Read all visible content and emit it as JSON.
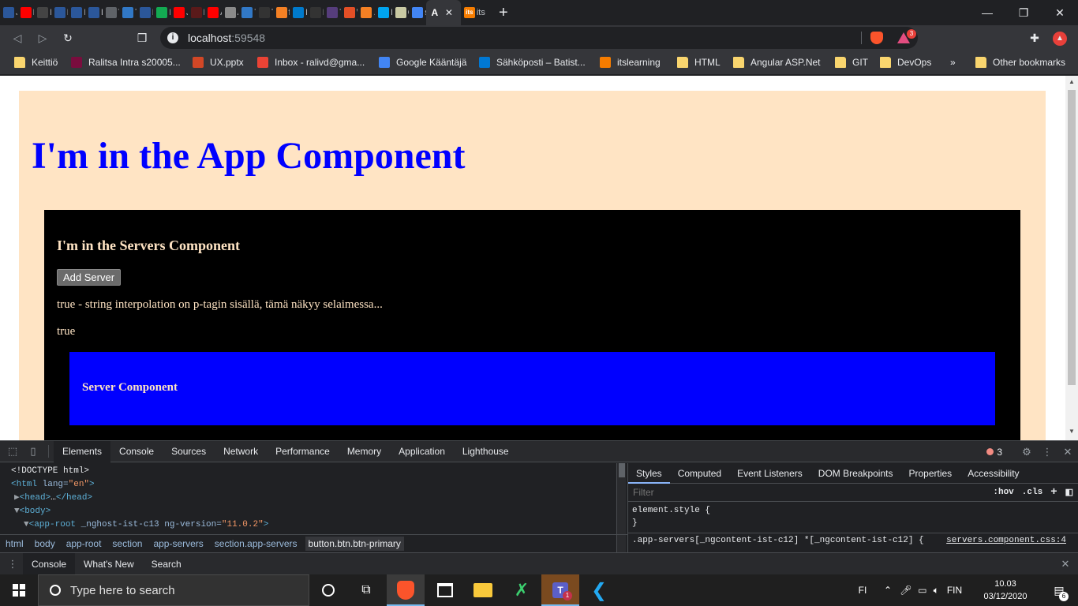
{
  "browser": {
    "tabs": [
      {
        "label": "Ja",
        "icon": "doc-icon",
        "color": "#2b579a"
      },
      {
        "label": "Le",
        "icon": "youtube-icon",
        "color": "#ff0000"
      },
      {
        "label": "Fr",
        "icon": "r-icon",
        "color": "#444444"
      },
      {
        "label": "Le",
        "icon": "doc-icon",
        "color": "#2b579a"
      },
      {
        "label": "Le",
        "icon": "doc-icon",
        "color": "#2b579a"
      },
      {
        "label": "Le",
        "icon": "doc-icon",
        "color": "#2b579a"
      },
      {
        "label": "Th",
        "icon": "globe-icon",
        "color": "#5f6368"
      },
      {
        "label": "Ty",
        "icon": "ts-icon",
        "color": "#3178c6"
      },
      {
        "label": "Le",
        "icon": "doc-icon",
        "color": "#2b579a"
      },
      {
        "label": "Dc",
        "icon": "dc-icon",
        "color": "#13aa52"
      },
      {
        "label": "Ja",
        "icon": "youtube-icon",
        "color": "#ff0000"
      },
      {
        "label": "Le",
        "icon": "dot-icon",
        "color": "#5a1a1a"
      },
      {
        "label": "Ac",
        "icon": "youtube-icon",
        "color": "#ff0000"
      },
      {
        "label": "A:",
        "icon": "house-icon",
        "color": "#8a8a8a"
      },
      {
        "label": "Ty",
        "icon": "ts-icon",
        "color": "#3178c6"
      },
      {
        "label": "Th",
        "icon": "angular-icon",
        "color": "#333333"
      },
      {
        "label": "fir",
        "icon": "stackoverflow-icon",
        "color": "#f48024"
      },
      {
        "label": "M",
        "icon": "feather-icon",
        "color": "#007acc"
      },
      {
        "label": "Le",
        "icon": "angular-icon",
        "color": "#333333"
      },
      {
        "label": "Ta",
        "icon": "b-icon",
        "color": "#563d7c"
      },
      {
        "label": "W",
        "icon": "n-icon",
        "color": "#e34f26"
      },
      {
        "label": ".n",
        "icon": "stackoverflow-icon",
        "color": "#f48024"
      },
      {
        "label": "Hi",
        "icon": "windows-icon",
        "color": "#00a4ef"
      },
      {
        "label": "O",
        "icon": "jk-icon",
        "color": "#c9c9a3"
      },
      {
        "label": "st",
        "icon": "doc-icon",
        "color": "#4285f4"
      }
    ],
    "active_tab": {
      "label": "A",
      "icon": "angular-icon",
      "color": "#ffffff"
    },
    "last_tab": {
      "label": "its",
      "icon": "its-icon",
      "color": "#f57c00"
    },
    "new_tab_label": "+",
    "window_controls": {
      "minimize": "—",
      "restore": "❐",
      "close": "✕"
    },
    "url_host": "localhost",
    "url_port": ":59548",
    "shields_badge": "3",
    "bookmarks": [
      {
        "label": "Keittiö",
        "icon": "folder-icon",
        "color": "#f9d56e"
      },
      {
        "label": "Ralitsa Intra s20005...",
        "icon": "intra-icon",
        "color": "#7a0d3e"
      },
      {
        "label": "UX.pptx",
        "icon": "powerpoint-icon",
        "color": "#d24726"
      },
      {
        "label": "Inbox - ralivd@gma...",
        "icon": "gmail-icon",
        "color": "#ea4335"
      },
      {
        "label": "Google Kääntäjä",
        "icon": "translate-icon",
        "color": "#4285f4"
      },
      {
        "label": "Sähköposti – Batist...",
        "icon": "outlook-icon",
        "color": "#0078d4"
      },
      {
        "label": "itslearning",
        "icon": "its-icon",
        "color": "#f57c00"
      },
      {
        "label": "HTML",
        "icon": "folder-icon",
        "color": "#f9d56e"
      },
      {
        "label": "Angular ASP.Net",
        "icon": "folder-icon",
        "color": "#f9d56e"
      },
      {
        "label": "GIT",
        "icon": "folder-icon",
        "color": "#f9d56e"
      },
      {
        "label": "DevOps",
        "icon": "folder-icon",
        "color": "#f9d56e"
      }
    ],
    "bookmarks_more": "»",
    "other_bookmarks": "Other bookmarks"
  },
  "page": {
    "app_heading": "I'm in the App Component",
    "servers_heading": "I'm in the Servers Component",
    "add_server_label": "Add Server",
    "interpolation_text": "true - string interpolation on p-tagin sisällä, tämä näkyy selaimessa...",
    "property_text": "true",
    "server_heading": "Server Component",
    "colors": {
      "app_bg": "#ffe4c4",
      "heading": "#0000ff",
      "servers_bg": "#000000",
      "server_bg": "#0000ff"
    }
  },
  "devtools": {
    "tabs": [
      "Elements",
      "Console",
      "Sources",
      "Network",
      "Performance",
      "Memory",
      "Application",
      "Lighthouse"
    ],
    "selected_tab": "Elements",
    "error_count": "3",
    "dom_lines": [
      {
        "text": "<!DOCTYPE html>"
      },
      {
        "tag": "<html",
        "attr": " lang=",
        "val": "\"en\"",
        "end": ">"
      },
      {
        "tag": "<head>",
        "text": "…",
        "end": "</head>"
      },
      {
        "tag": "<body>"
      },
      {
        "tag": "<app-root",
        "attr": " _nghost-ist-c13 ng-version=",
        "val": "\"11.0.2\"",
        "end": ">"
      }
    ],
    "breadcrumbs": [
      "html",
      "body",
      "app-root",
      "section",
      "app-servers",
      "section.app-servers",
      "button.btn.btn-primary"
    ],
    "style_tabs": [
      "Styles",
      "Computed",
      "Event Listeners",
      "DOM Breakpoints",
      "Properties",
      "Accessibility"
    ],
    "filter_placeholder": "Filter",
    "hov_label": ":hov",
    "cls_label": ".cls",
    "element_style": "element.style {",
    "element_style_close": "}",
    "rule_selector": ".app-servers[_ngcontent-ist-c12] *[_ngcontent-ist-c12] {",
    "rule_source": "servers.component.css:4",
    "drawer_tabs": [
      "Console",
      "What's New",
      "Search"
    ]
  },
  "taskbar": {
    "search_placeholder": "Type here to search",
    "language": "FI",
    "keyboard": "FIN",
    "time": "10.03",
    "date": "03/12/2020",
    "notification_count": "6",
    "teams_badge": "1"
  }
}
